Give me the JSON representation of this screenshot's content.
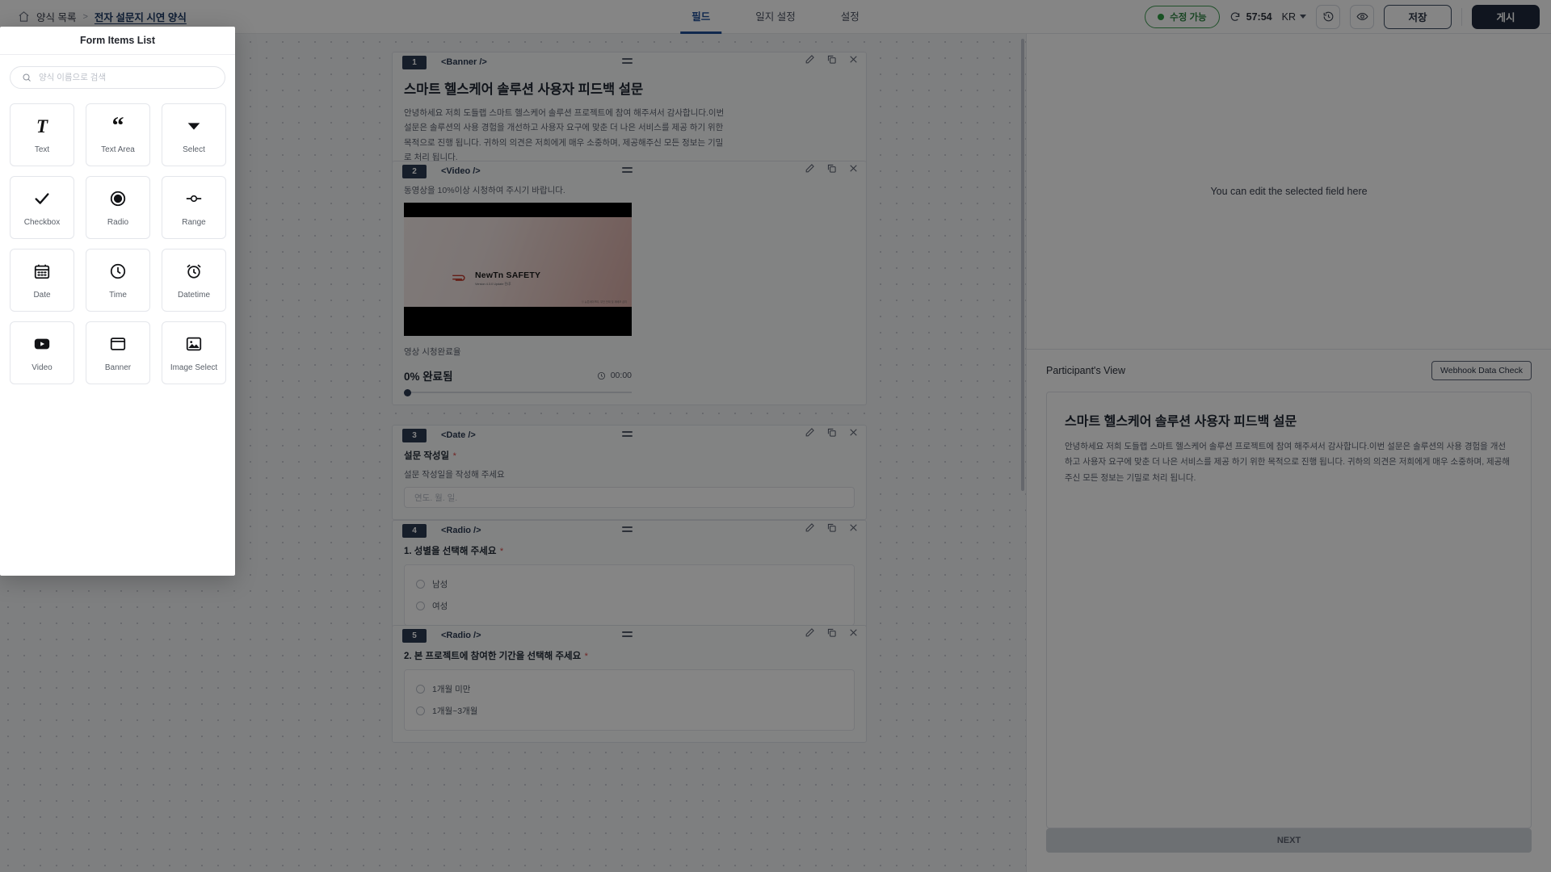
{
  "topbar": {
    "home_icon": "home-icon",
    "breadcrumb_root": "양식 목록",
    "breadcrumb_sep": "＞",
    "breadcrumb_current": "전자 설문지 시연 양식",
    "tabs": [
      {
        "label": "필드",
        "active": true
      },
      {
        "label": "일지 설정",
        "active": false
      },
      {
        "label": "설정",
        "active": false
      }
    ],
    "status_chip": "수정 가능",
    "status_color": "#2f9e44",
    "refresh_icon": "refresh-icon",
    "timer": "57:54",
    "language": "KR",
    "history_icon": "history-clock-icon",
    "preview_icon": "eye-icon",
    "save_label": "저장",
    "publish_label": "게시"
  },
  "modal": {
    "title": "Form Items List",
    "search_placeholder": "양식 이름으로 검색",
    "search_value": "",
    "search_icon": "search-icon",
    "items": [
      {
        "label": "Text",
        "icon": "text-icon"
      },
      {
        "label": "Text Area",
        "icon": "quote-icon"
      },
      {
        "label": "Select",
        "icon": "chevron-down-icon"
      },
      {
        "label": "Checkbox",
        "icon": "check-icon"
      },
      {
        "label": "Radio",
        "icon": "radio-icon"
      },
      {
        "label": "Range",
        "icon": "range-slider-icon"
      },
      {
        "label": "Date",
        "icon": "calendar-icon"
      },
      {
        "label": "Time",
        "icon": "clock-icon"
      },
      {
        "label": "Datetime",
        "icon": "alarm-clock-icon"
      },
      {
        "label": "Video",
        "icon": "video-icon"
      },
      {
        "label": "Banner",
        "icon": "banner-icon"
      },
      {
        "label": "Image Select",
        "icon": "image-icon"
      }
    ]
  },
  "canvas": {
    "blocks": [
      {
        "num": "1",
        "tag": "<Banner />",
        "title": "스마트 헬스케어 솔루션 사용자 피드백 설문",
        "body": "안녕하세요 저희 도들랩 스마트 헬스케어 솔루션 프로젝트에 참여 해주셔서 감사합니다.이번 설문은 솔루션의 사용 경험을 개선하고 사용자 요구에 맞춘 더 나은 서비스를 제공 하기 위한 목적으로 진행 됩니다. 귀하의 의견은 저희에게 매우 소중하며, 제공해주신 모든 정보는 기밀로 처리 됩니다."
      },
      {
        "num": "2",
        "tag": "<Video />",
        "hint": "동영상을 10%이상 시청하여 주시기 바랍니다.",
        "video_logo_name": "NewTn SAFETY",
        "video_logo_sub": "Version 4.3.0 Update 전/후",
        "video_footnote": "ⓒ 뉴튼세이프티. 무단 전재 및 재배포 금지",
        "progress_label": "영상 시청완료율",
        "progress_percent": "0% 완료됨",
        "progress_value": 0,
        "elapsed": "00:00",
        "clock_icon": "clock-icon"
      },
      {
        "num": "3",
        "tag": "<Date />",
        "label": "설문 작성일",
        "required": "*",
        "hint": "설문 작성일을 작성해 주세요",
        "input_placeholder": "연도. 월. 일."
      },
      {
        "num": "4",
        "tag": "<Radio />",
        "label": "1. 성별을 선택해 주세요",
        "required": "*",
        "options": [
          "남성",
          "여성"
        ]
      },
      {
        "num": "5",
        "tag": "<Radio />",
        "label": "2. 본 프로젝트에 참여한 기간을 선택해 주세요",
        "required": "*",
        "options": [
          "1개월 미만",
          "1개월~3개월"
        ]
      }
    ],
    "block_actions": {
      "edit_icon": "pencil-icon",
      "copy_icon": "copy-icon",
      "close_icon": "close-icon",
      "drag_icon": "drag-handle-icon"
    }
  },
  "inspector": {
    "empty_message": "You can edit the selected field here",
    "participant_view_title": "Participant's View",
    "webhook_button": "Webhook Data Check",
    "preview": {
      "title": "스마트 헬스케어 솔루션 사용자 피드백 설문",
      "body": "안녕하세요 저희 도들랩 스마트 헬스케어 솔루션 프로젝트에 참여 해주셔서 감사합니다.이번 설문은 솔루션의 사용 경험을 개선하고 사용자 요구에 맞춘 더 나은 서비스를 제공 하기 위한 목적으로 진행 됩니다. 귀하의 의견은 저희에게 매우 소중하며, 제공해주신 모든 정보는 기밀로 처리 됩니다."
    },
    "next_button": "NEXT"
  }
}
